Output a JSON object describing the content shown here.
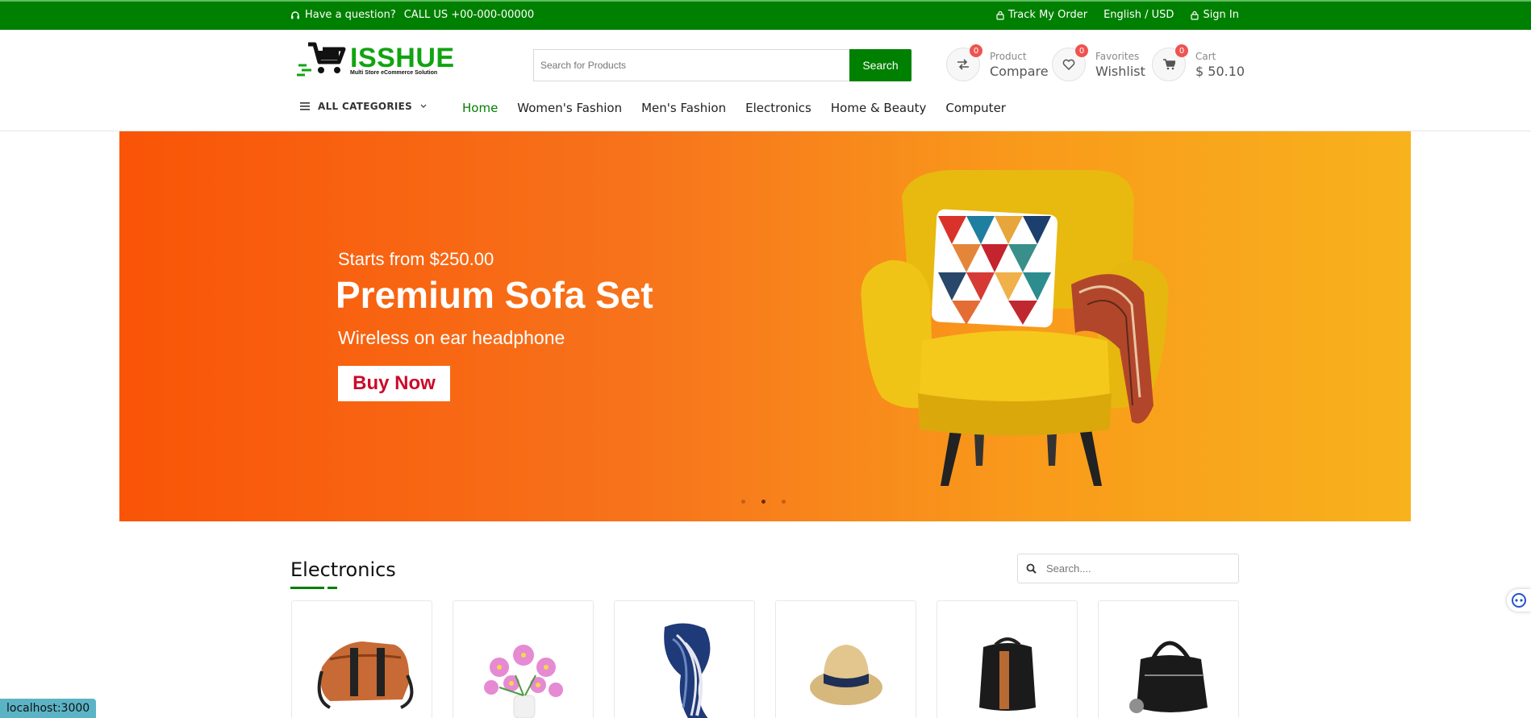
{
  "topbar": {
    "question": "Have a question?",
    "phone": "CALL US +00-000-00000",
    "track": "Track My Order",
    "lang": "English / USD",
    "signin": "Sign In"
  },
  "logo": {
    "main": "ISSHUE",
    "sub": "Multi Store eCommerce Solution"
  },
  "search": {
    "placeholder": "Search for Products",
    "button": "Search"
  },
  "header_items": [
    {
      "small": "Product",
      "big": "Compare",
      "badge": "0",
      "icon": "compare-icon"
    },
    {
      "small": "Favorites",
      "big": "Wishlist",
      "badge": "0",
      "icon": "heart-icon"
    },
    {
      "small": "Cart",
      "big": "$ 50.10",
      "badge": "0",
      "icon": "cart-icon"
    }
  ],
  "nav": {
    "categories": "ALL CATEGORIES",
    "items": [
      "Home",
      "Women's Fashion",
      "Men's Fashion",
      "Electronics",
      "Home & Beauty",
      "Computer"
    ]
  },
  "hero": {
    "subtitle": "Starts from $250.00",
    "title": "Premium Sofa Set",
    "description": "Wireless on ear headphone",
    "button": "Buy Now"
  },
  "section": {
    "title": "Electronics",
    "search_placeholder": "Search...."
  },
  "products": [
    "bag-icon",
    "flowers-icon",
    "scarf-icon",
    "hat-icon",
    "backpack-icon",
    "handbag-icon"
  ],
  "status": {
    "url": "localhost:3000"
  },
  "colors": {
    "brand_green": "#008000",
    "badge_red": "#ef5350",
    "hero_start": "#f95407",
    "hero_end": "#f8b21c",
    "button_text": "#cc0a2a"
  }
}
